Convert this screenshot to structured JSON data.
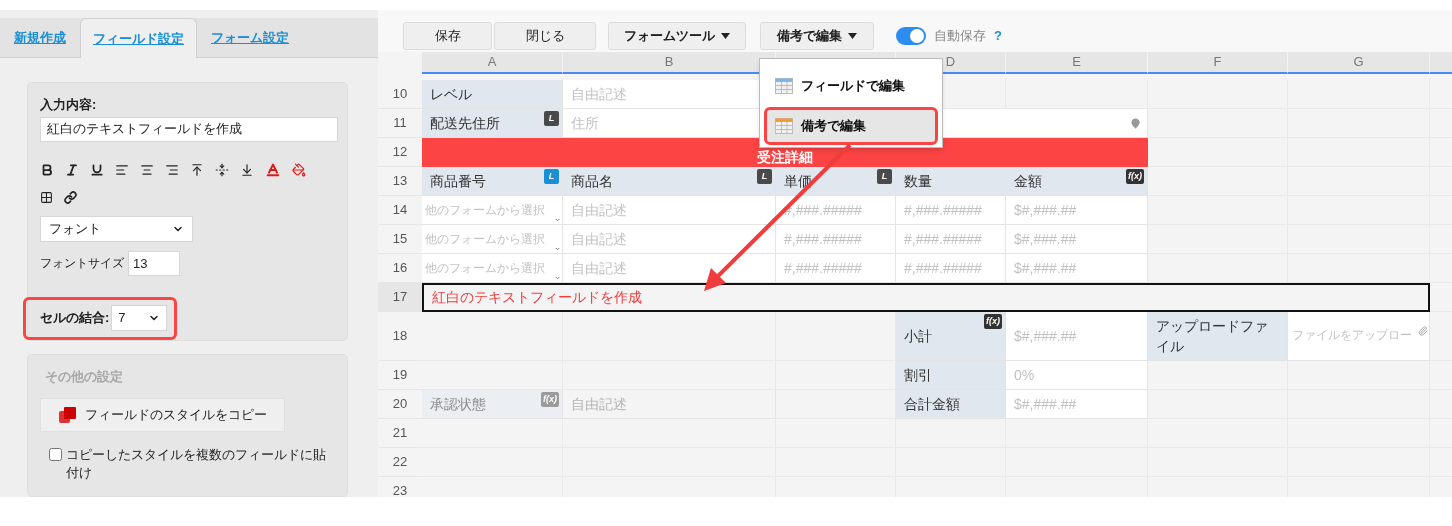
{
  "sidebar": {
    "tabs": [
      {
        "label": "新規作成",
        "selected": false
      },
      {
        "label": "フィールド設定",
        "selected": true
      },
      {
        "label": "フォーム設定",
        "selected": false
      }
    ],
    "content_label": "入力内容:",
    "content_value": "紅白のテキストフィールドを作成",
    "font_select": "フォント",
    "font_size_label": "フォントサイズ",
    "font_size_value": "13",
    "merge_label": "セルの結合:",
    "merge_value": "7",
    "other": {
      "title": "その他の設定",
      "copy_button": "フィールドのスタイルをコピー",
      "paste_checkbox": {
        "label": "コピーしたスタイルを複数のフィールドに貼付け",
        "checked": false
      }
    }
  },
  "toolbar": {
    "buttons": [
      {
        "label": "保存",
        "kind": "plain"
      },
      {
        "label": "閉じる",
        "kind": "plain"
      },
      {
        "label": "フォームツール",
        "kind": "menu"
      },
      {
        "label": "備考で編集",
        "kind": "menu"
      }
    ],
    "autosave": {
      "label": "自動保存",
      "on": true
    },
    "help": "?"
  },
  "menu": {
    "items": [
      {
        "label": "フィールドで編集",
        "selected": false,
        "color": "#7fb6e8"
      },
      {
        "label": "備考で編集",
        "selected": true,
        "color": "#f39c34"
      }
    ]
  },
  "sheet": {
    "columns": [
      "A",
      "B",
      null,
      "D",
      "E",
      "F",
      "G"
    ],
    "rows": [
      {
        "number": "10",
        "selected": false,
        "cells": [
          {
            "kind": "label",
            "text": "レベル"
          },
          {
            "kind": "input",
            "text": "自由記述"
          },
          {
            "kind": "merged"
          },
          {
            "kind": "empty"
          },
          {
            "kind": "empty"
          },
          {
            "kind": "empty"
          },
          {
            "kind": "empty"
          }
        ]
      },
      {
        "number": "11",
        "selected": false,
        "cells": [
          {
            "kind": "label",
            "text": "配送先住所",
            "badge": {
              "text": "L",
              "color": "#4a4a4a"
            }
          },
          {
            "kind": "address",
            "text": "住所"
          },
          {
            "kind": "merged"
          },
          {
            "kind": "merged"
          },
          {
            "kind": "merged"
          },
          {
            "kind": "empty"
          },
          {
            "kind": "empty"
          }
        ]
      },
      {
        "number": "12",
        "selected": false,
        "cells": [
          {
            "kind": "section",
            "text": "受注詳細"
          },
          {
            "kind": "merged"
          },
          {
            "kind": "merged"
          },
          {
            "kind": "merged"
          },
          {
            "kind": "merged"
          },
          {
            "kind": "empty"
          },
          {
            "kind": "empty"
          }
        ]
      },
      {
        "number": "13",
        "selected": false,
        "cells": [
          {
            "kind": "label",
            "text": "商品番号",
            "badge": {
              "text": "L",
              "color": "#1a8fd6"
            }
          },
          {
            "kind": "label",
            "text": "商品名",
            "badge": {
              "text": "L",
              "color": "#4a4a4a"
            }
          },
          {
            "kind": "label",
            "text": "単価",
            "badge": {
              "text": "L",
              "color": "#4a4a4a"
            }
          },
          {
            "kind": "label",
            "text": "数量"
          },
          {
            "kind": "label",
            "text": "金額",
            "badge": {
              "text": "f(x)",
              "color": "#333333"
            }
          },
          {
            "kind": "empty"
          },
          {
            "kind": "empty"
          }
        ]
      },
      {
        "number": "14",
        "selected": false,
        "cells": [
          {
            "kind": "select",
            "text": "他のフォームから選択"
          },
          {
            "kind": "input",
            "text": "自由記述"
          },
          {
            "kind": "input",
            "text": "#,###.#####"
          },
          {
            "kind": "input",
            "text": "#,###.#####"
          },
          {
            "kind": "input",
            "text": "$#,###.##"
          },
          {
            "kind": "empty"
          },
          {
            "kind": "empty"
          }
        ]
      },
      {
        "number": "15",
        "selected": false,
        "cells": [
          {
            "kind": "select",
            "text": "他のフォームから選択"
          },
          {
            "kind": "input",
            "text": "自由記述"
          },
          {
            "kind": "input",
            "text": "#,###.#####"
          },
          {
            "kind": "input",
            "text": "#,###.#####"
          },
          {
            "kind": "input",
            "text": "$#,###.##"
          },
          {
            "kind": "empty"
          },
          {
            "kind": "empty"
          }
        ]
      },
      {
        "number": "16",
        "selected": false,
        "cells": [
          {
            "kind": "select",
            "text": "他のフォームから選択"
          },
          {
            "kind": "input",
            "text": "自由記述"
          },
          {
            "kind": "input",
            "text": "#,###.#####"
          },
          {
            "kind": "input",
            "text": "#,###.#####"
          },
          {
            "kind": "input",
            "text": "$#,###.##"
          },
          {
            "kind": "empty"
          },
          {
            "kind": "empty"
          }
        ]
      },
      {
        "number": "17",
        "selected": true,
        "cells": [
          {
            "kind": "note",
            "text": "紅白のテキストフィールドを作成"
          },
          {
            "kind": "merged"
          },
          {
            "kind": "merged"
          },
          {
            "kind": "merged"
          },
          {
            "kind": "merged"
          },
          {
            "kind": "merged"
          },
          {
            "kind": "merged"
          }
        ]
      },
      {
        "number": "18",
        "selected": false,
        "cells": [
          {
            "kind": "empty"
          },
          {
            "kind": "empty"
          },
          {
            "kind": "empty"
          },
          {
            "kind": "label",
            "text": "小計",
            "badge": {
              "text": "f(x)",
              "color": "#333333"
            }
          },
          {
            "kind": "input",
            "text": "$#,###.##"
          },
          {
            "kind": "label",
            "text": "アップロードファイル"
          },
          {
            "kind": "upload",
            "text": "ファイルをアップロー"
          }
        ]
      },
      {
        "number": "19",
        "selected": false,
        "cells": [
          {
            "kind": "empty"
          },
          {
            "kind": "empty"
          },
          {
            "kind": "empty"
          },
          {
            "kind": "label",
            "text": "割引"
          },
          {
            "kind": "input",
            "text": "0%"
          },
          {
            "kind": "empty"
          },
          {
            "kind": "empty"
          }
        ]
      },
      {
        "number": "20",
        "selected": false,
        "cells": [
          {
            "kind": "mutedlabel",
            "text": "承認状態",
            "badge": {
              "text": "f(x)",
              "color": "#9a9a9a"
            }
          },
          {
            "kind": "mutedinput",
            "text": "自由記述"
          },
          {
            "kind": "empty"
          },
          {
            "kind": "label",
            "text": "合計金額"
          },
          {
            "kind": "input",
            "text": "$#,###.##"
          },
          {
            "kind": "empty"
          },
          {
            "kind": "empty"
          }
        ]
      },
      {
        "number": "21",
        "selected": false,
        "cells": [
          {
            "kind": "empty"
          },
          {
            "kind": "empty"
          },
          {
            "kind": "empty"
          },
          {
            "kind": "empty"
          },
          {
            "kind": "empty"
          },
          {
            "kind": "empty"
          },
          {
            "kind": "empty"
          }
        ]
      },
      {
        "number": "22",
        "selected": false,
        "cells": [
          {
            "kind": "empty"
          },
          {
            "kind": "empty"
          },
          {
            "kind": "empty"
          },
          {
            "kind": "empty"
          },
          {
            "kind": "empty"
          },
          {
            "kind": "empty"
          },
          {
            "kind": "empty"
          }
        ]
      },
      {
        "number": "23",
        "selected": false,
        "cells": [
          {
            "kind": "empty"
          },
          {
            "kind": "empty"
          },
          {
            "kind": "empty"
          },
          {
            "kind": "empty"
          },
          {
            "kind": "empty"
          },
          {
            "kind": "empty"
          },
          {
            "kind": "empty"
          }
        ]
      }
    ]
  }
}
